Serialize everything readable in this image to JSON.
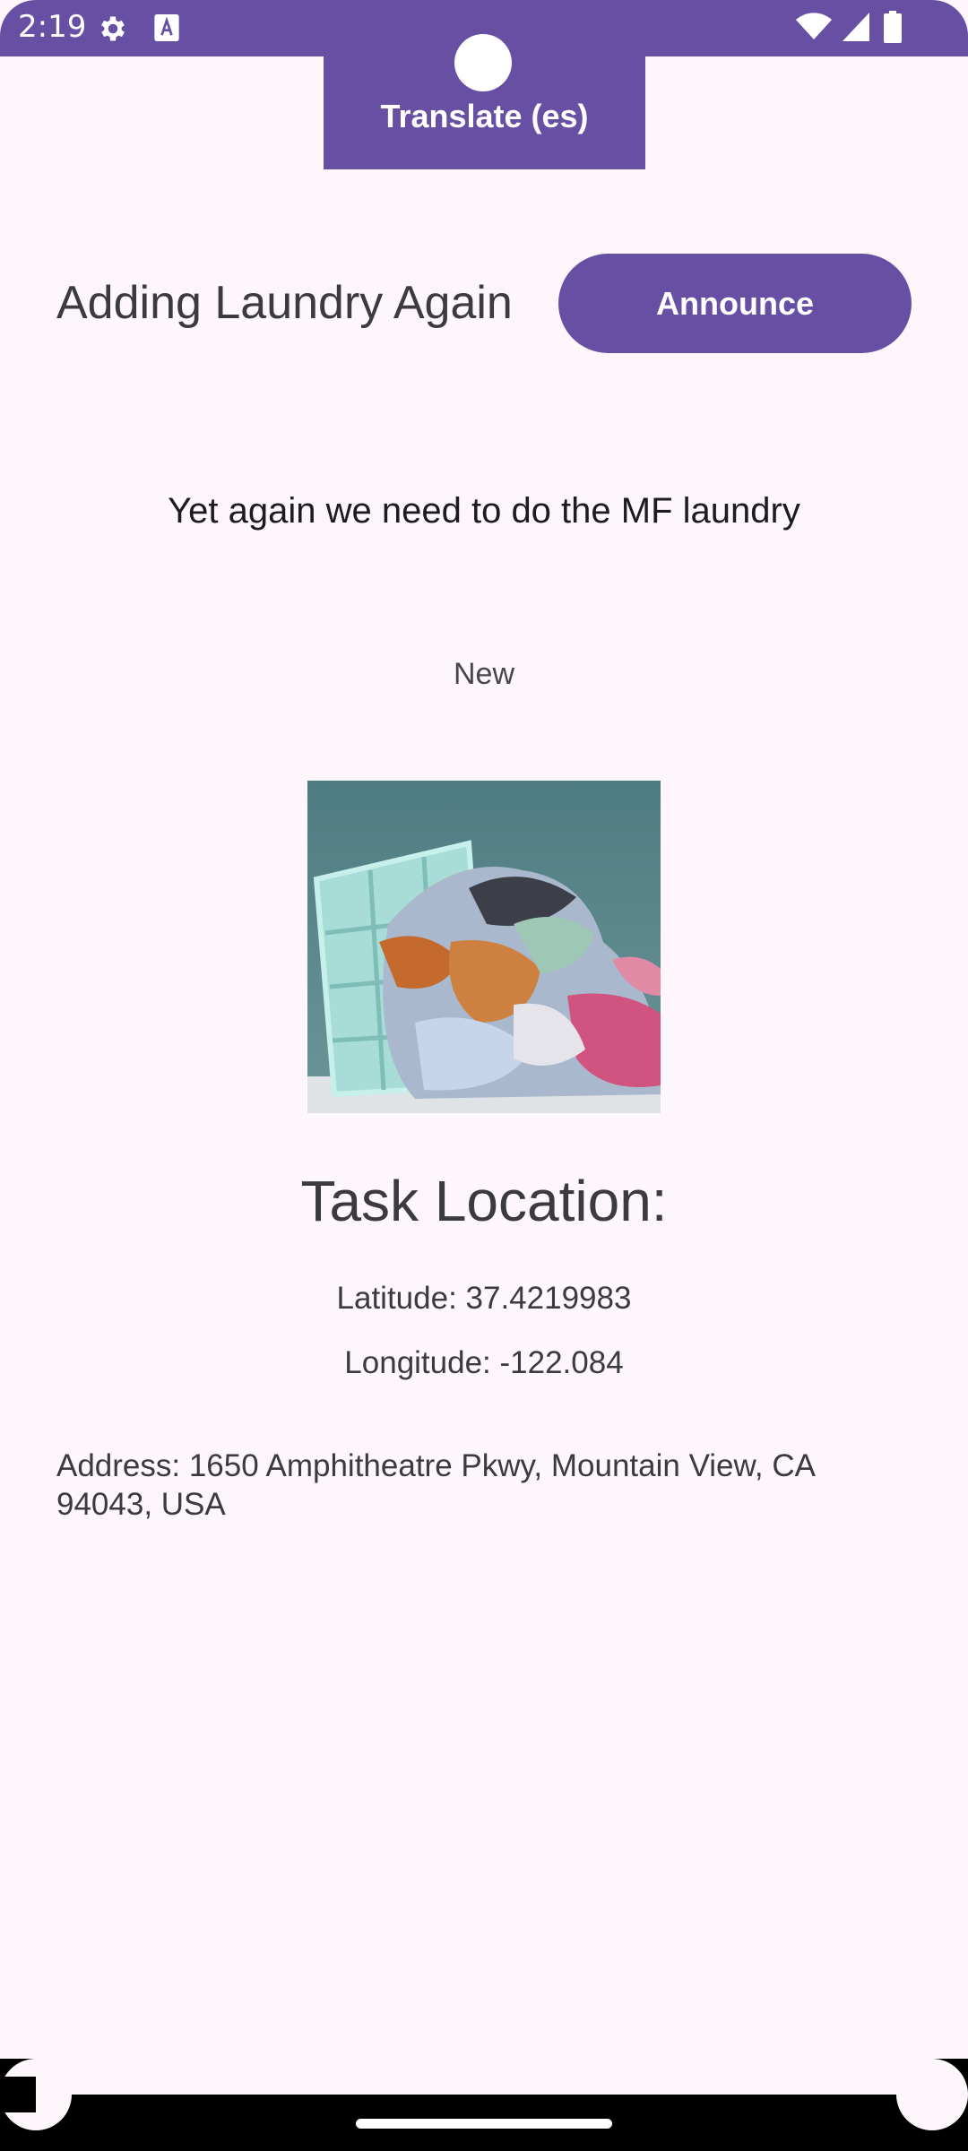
{
  "status_bar": {
    "time": "2:19",
    "icons": [
      "gear-icon",
      "a-icon",
      "wifi-icon",
      "signal-icon",
      "battery-icon"
    ]
  },
  "toolbar": {
    "translate_label": "Translate (es)"
  },
  "task": {
    "title": "Adding Laundry Again",
    "announce_label": "Announce",
    "description": "Yet again we need to do the MF laundry",
    "status": "New"
  },
  "location": {
    "heading": "Task Location:",
    "latitude": "Latitude: 37.4219983",
    "longitude": "Longitude: -122.084",
    "address": "Address: 1650 Amphitheatre Pkwy, Mountain View, CA 94043, USA"
  },
  "colors": {
    "accent": "#6750a4",
    "background": "#fdf7fb",
    "text": "#3a3a3f"
  }
}
